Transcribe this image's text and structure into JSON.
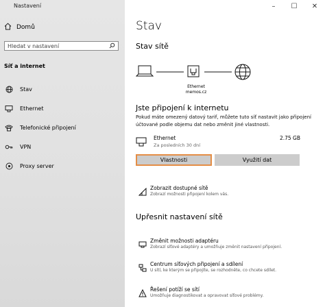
{
  "window": {
    "title": "Nastavení",
    "controls": [
      "–",
      "☐",
      "✕"
    ]
  },
  "sidebar": {
    "home_label": "Domů",
    "search_placeholder": "Hledat v nastavení",
    "section": "Síť a internet",
    "items": [
      {
        "label": "Stav",
        "icon": "globe-icon"
      },
      {
        "label": "Ethernet",
        "icon": "ethernet-icon"
      },
      {
        "label": "Telefonické připojení",
        "icon": "dialup-icon"
      },
      {
        "label": "VPN",
        "icon": "vpn-icon"
      },
      {
        "label": "Proxy server",
        "icon": "proxy-icon"
      }
    ]
  },
  "main": {
    "title": "Stav",
    "network_status_heading": "Stav sítě",
    "network_label_line1": "Ethernet",
    "network_label_line2": "memos.cz",
    "connected_heading": "Jste připojení k internetu",
    "connected_desc": "Pokud máte omezený datový tarif, můžete tuto síť nastavit jako připojení účtované podle objemu dat nebo změnit jiné vlastnosti.",
    "adapter": {
      "name": "Ethernet",
      "period": "Za posledních 30 dní",
      "usage": "2.75 GB"
    },
    "buttons": {
      "properties": "Vlastnosti",
      "data_usage": "Využití dat"
    },
    "show_networks": {
      "title": "Zobrazit dostupné sítě",
      "desc": "Zobrazí možnosti připojení kolem vás."
    },
    "advanced_heading": "Upřesnit nastavení sítě",
    "advanced_items": [
      {
        "title": "Změnit možnosti adaptéru",
        "desc": "Zobrazí síťové adaptéry a umožňuje změnit nastavení připojení."
      },
      {
        "title": "Centrum síťových připojení a sdílení",
        "desc": "U sítí, ke kterým se připojíte, se rozhodněte, co chcete sdílet."
      },
      {
        "title": "Řešení potíží se sítí",
        "desc": "Umožňuje diagnostikovat a opravovat síťové problémy."
      }
    ]
  }
}
